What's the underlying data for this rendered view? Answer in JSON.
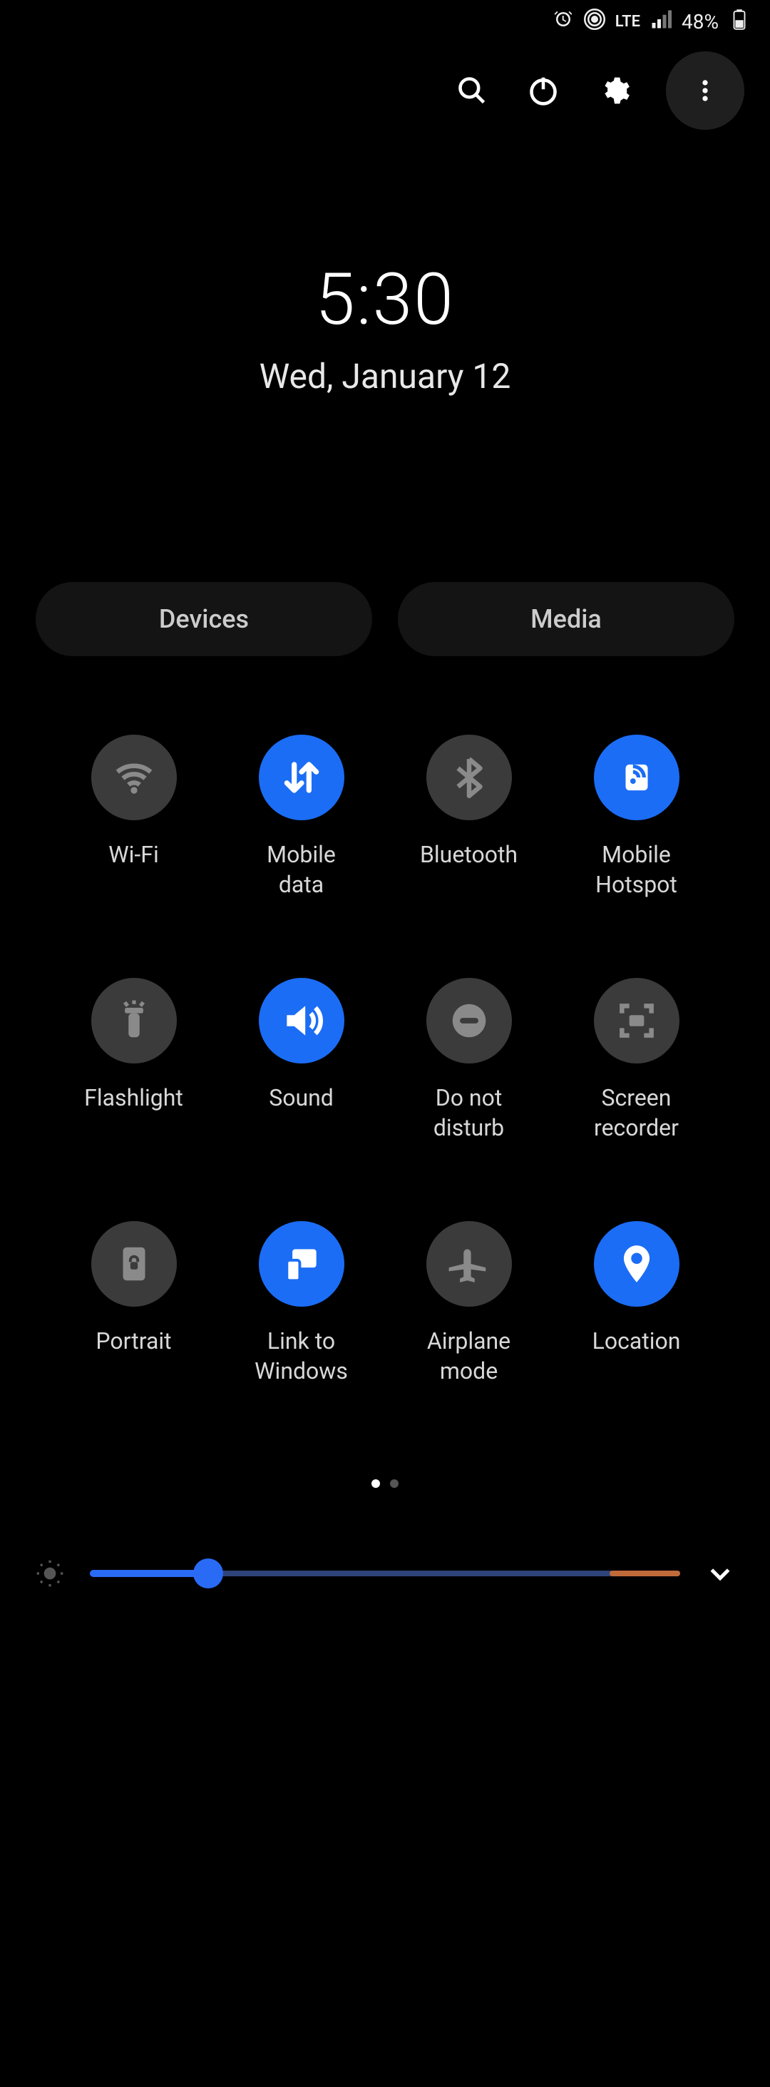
{
  "status": {
    "alarm_icon": "alarm-icon",
    "hotspot_icon": "hotspot-status-icon",
    "network_type": "LTE",
    "signal_icon": "signal-icon",
    "battery_percent": "48%",
    "battery_icon": "battery-icon"
  },
  "top_actions": {
    "search_icon": "search-icon",
    "power_icon": "power-icon",
    "settings_icon": "settings-icon",
    "more_icon": "more-icon"
  },
  "clock": {
    "time": "5:30",
    "date": "Wed, January 12"
  },
  "panels": {
    "devices": "Devices",
    "media": "Media"
  },
  "tiles": [
    {
      "key": "wifi",
      "label": "Wi-Fi",
      "active": false,
      "icon": "wifi-icon"
    },
    {
      "key": "mdata",
      "label": "Mobile\ndata",
      "active": true,
      "icon": "data-arrows-icon"
    },
    {
      "key": "bt",
      "label": "Bluetooth",
      "active": false,
      "icon": "bluetooth-icon"
    },
    {
      "key": "hotspot",
      "label": "Mobile\nHotspot",
      "active": true,
      "icon": "hotspot-icon"
    },
    {
      "key": "flash",
      "label": "Flashlight",
      "active": false,
      "icon": "flashlight-icon"
    },
    {
      "key": "sound",
      "label": "Sound",
      "active": true,
      "icon": "speaker-icon"
    },
    {
      "key": "dnd",
      "label": "Do not\ndisturb",
      "active": false,
      "icon": "dnd-icon"
    },
    {
      "key": "srec",
      "label": "Screen\nrecorder",
      "active": false,
      "icon": "screen-record-icon"
    },
    {
      "key": "portrait",
      "label": "Portrait",
      "active": false,
      "icon": "portrait-lock-icon"
    },
    {
      "key": "link",
      "label": "Link to\nWindows",
      "active": true,
      "icon": "link-windows-icon"
    },
    {
      "key": "airplane",
      "label": "Airplane\nmode",
      "active": false,
      "icon": "airplane-icon"
    },
    {
      "key": "location",
      "label": "Location",
      "active": true,
      "icon": "location-icon"
    }
  ],
  "pagination": {
    "current": 0,
    "total": 2
  },
  "brightness": {
    "value_percent": 20,
    "warn_threshold_percent": 88,
    "sun_icon": "brightness-icon",
    "expand_icon": "chevron-down-icon"
  }
}
